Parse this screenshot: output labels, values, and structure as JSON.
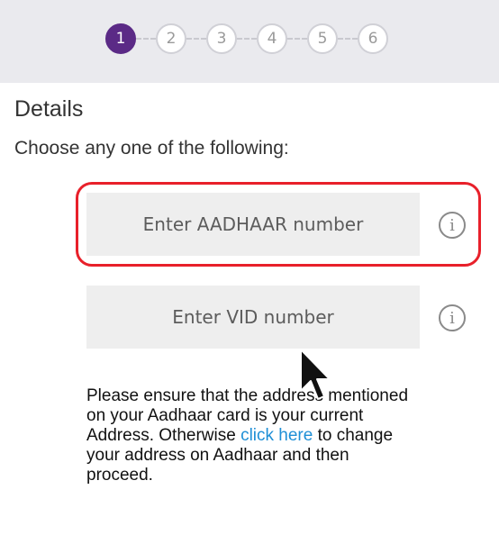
{
  "stepper": {
    "steps": [
      "1",
      "2",
      "3",
      "4",
      "5",
      "6"
    ],
    "active_index": 0
  },
  "details": {
    "title": "Details",
    "instruction": "Choose any one of the following:"
  },
  "aadhaar_field": {
    "placeholder": "Enter AADHAAR number",
    "value": ""
  },
  "vid_field": {
    "placeholder": "Enter VID number",
    "value": ""
  },
  "info_icon_glyph": "i",
  "notice": {
    "text_before": "Please ensure that the address mentioned on your Aadhaar card is your current Address. Otherwise ",
    "link_text": "click here",
    "text_after": " to change your address on Aadhaar and then proceed."
  },
  "colors": {
    "active_step": "#5b2a86",
    "highlight_border": "#e8202a",
    "link": "#1e8fd6"
  },
  "icons": {
    "info": "info-circle-icon",
    "cursor": "mouse-pointer-icon"
  }
}
